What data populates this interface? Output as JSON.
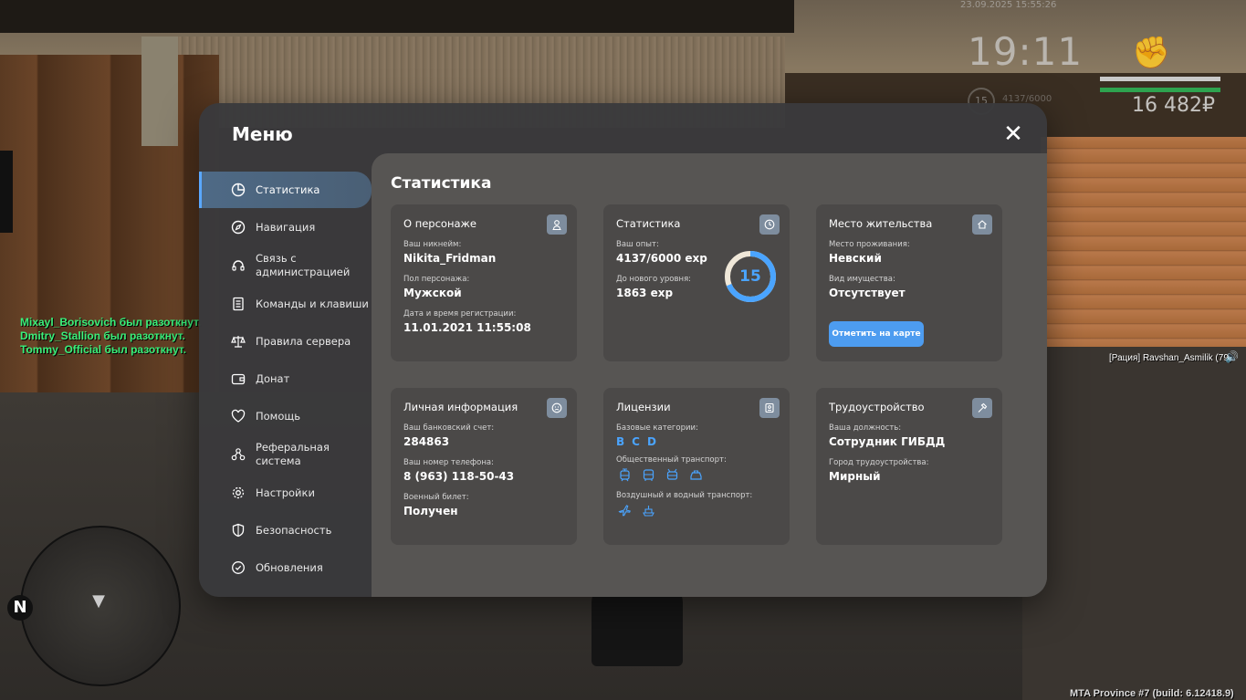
{
  "hud": {
    "date": "23.09.2025 15:55:26",
    "time": "19:11",
    "money": "16 482₽",
    "level": "15",
    "exp": "4137/6000"
  },
  "chat": [
    "Mixayl_Borisovich был разоткнут.",
    "Dmitry_Stallion был разоткнут.",
    "Tommy_Official был разоткнут."
  ],
  "voice": "[Рация] Ravshan_Asmilik (79)",
  "build": "MTA Province #7 (build: 6.12418.9)",
  "radar": {
    "north": "N"
  },
  "menu": {
    "title": "Меню",
    "sidebar": [
      {
        "label": "Статистика",
        "icon": "chart-icon"
      },
      {
        "label": "Навигация",
        "icon": "compass-icon"
      },
      {
        "label": "Связь с администрацией",
        "icon": "headset-icon"
      },
      {
        "label": "Команды и клавиши",
        "icon": "document-icon"
      },
      {
        "label": "Правила сервера",
        "icon": "scales-icon"
      },
      {
        "label": "Донат",
        "icon": "wallet-icon"
      },
      {
        "label": "Помощь",
        "icon": "heart-handshake-icon"
      },
      {
        "label": "Реферальная система",
        "icon": "users-icon"
      },
      {
        "label": "Настройки",
        "icon": "gear-icon"
      },
      {
        "label": "Безопасность",
        "icon": "shield-icon"
      },
      {
        "label": "Обновления",
        "icon": "refresh-icon"
      }
    ],
    "content": {
      "title": "Статистика",
      "character": {
        "title": "О персонаже",
        "nick_label": "Ваш никнейм:",
        "nick": "Nikita_Fridman",
        "gender_label": "Пол персонажа:",
        "gender": "Мужской",
        "reg_label": "Дата и время регистрации:",
        "reg": "11.01.2021 11:55:08"
      },
      "stats": {
        "title": "Статистика",
        "exp_label": "Ваш опыт:",
        "exp": "4137/6000 exp",
        "next_label": "До нового уровня:",
        "next": "1863 exp",
        "level": "15",
        "progress": 0.6895
      },
      "residence": {
        "title": "Место жительства",
        "place_label": "Место проживания:",
        "place": "Невский",
        "property_label": "Вид имущества:",
        "property": "Отсутствует",
        "map_button": "Отметить на карте"
      },
      "personal": {
        "title": "Личная информация",
        "bank_label": "Ваш банковский счет:",
        "bank": "284863",
        "phone_label": "Ваш номер телефона:",
        "phone": "8 (963) 118-50-43",
        "military_label": "Военный билет:",
        "military": "Получен"
      },
      "licenses": {
        "title": "Лицензии",
        "base_label": "Базовые категории:",
        "base": [
          "B",
          "C",
          "D"
        ],
        "public_label": "Общественный транспорт:",
        "public_icons": [
          "tram-icon",
          "bus-icon",
          "trolleybus-icon",
          "taxi-icon"
        ],
        "air_label": "Воздушный и водный транспорт:",
        "air_icons": [
          "plane-icon",
          "boat-icon"
        ]
      },
      "job": {
        "title": "Трудоустройство",
        "position_label": "Ваша должность:",
        "position": "Сотрудник ГИБДД",
        "city_label": "Город трудоустройства:",
        "city": "Мирный"
      }
    }
  },
  "colors": {
    "accent": "#4aa4ff",
    "button": "#4d9cf0",
    "chat": "#3af07a"
  }
}
